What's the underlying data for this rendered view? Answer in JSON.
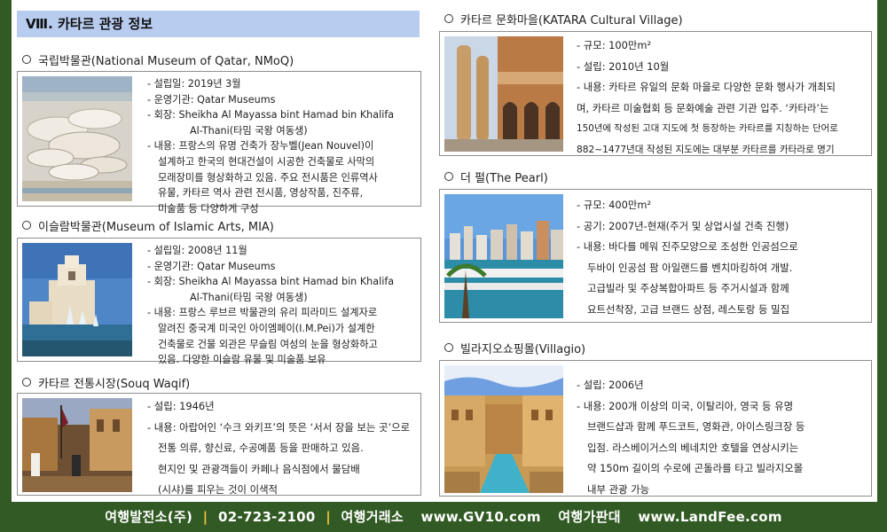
{
  "section_title": "Ⅷ. 카타르 관광 정보",
  "left": [
    {
      "heading": "국립박물관(National Museum of Qatar, NMoQ)",
      "image": "national-museum-photo",
      "lines": [
        "- 설립일: 2019년 3월",
        "- 운영기관: Qatar Museums",
        "- 회장: Sheikha Al Mayassa bint Hamad bin Khalifa",
        "Al-Thani(타밈 국왕 여동생)",
        "- 내용: 프랑스의 유명 건축가 장누벨(Jean Nouvel)이",
        "설계하고 한국의 현대건설이 시공한 건축물로 사막의",
        "모래장미를 형상화하고 있음. 주요 전시품은 인류역사",
        "유물, 카타르 역사 관련 전시품,  영상작품, 진주류,",
        "미술품 등 다양하게 구성"
      ]
    },
    {
      "heading": "이슬람박물관(Museum of Islamic Arts, MIA)",
      "image": "islamic-museum-photo",
      "lines": [
        "- 설립일: 2008년 11월",
        "- 운영기관: Qatar Museums",
        "- 회장: Sheikha Al Mayassa bint Hamad bin Khalifa",
        "Al-Thani(타밈 국왕 여동생)",
        "- 내용: 프랑스 루브르 박물관의 유리 피라미드 설계자로",
        "알려진 중국계 미국인 아이엠페이(I.M.Pei)가 설계한",
        "건축물로 건물 외관은 무슬림 여성의 눈을 형상화하고",
        "있음. 다양한 이슬람 유물 및 미술품 보유"
      ]
    },
    {
      "heading": "카타르 전통시장(Souq Waqif)",
      "image": "souq-waqif-photo",
      "lines": [
        "- 설립: 1946년",
        "- 내용: 아랍어인 ‘수크 와키프’의 뜻은 ‘서서 장을  보는 곳’으로",
        "전통 의류, 향신료, 수공예품 등을 판매하고 있음.",
        "현지인 및  관광객들이 카페나 음식점에서 물담배",
        "(시샤)를 피우는 것이 이색적"
      ]
    }
  ],
  "right": [
    {
      "heading": "카타르 문화마을(KATARA Cultural Village)",
      "image": "katara-village-photo",
      "lines": [
        "- 규모: 100만m²",
        "- 설립: 2010년 10월",
        "- 내용: 카타르 유일의 문화 마을로 다양한 문화 행사가 개최되",
        "며, 카타르 미술협회 등 문화예술 관련  기관 입주. ‘카타라’는",
        "150년에 작성된 고대 지도에 첫 등장하는 카타르를 지칭하는 단어로",
        "882~1477년대 작성된 지도에는 대부분 카타르를 카타라로 명기"
      ]
    },
    {
      "heading": "더 펄(The Pearl)",
      "image": "the-pearl-photo",
      "lines": [
        "- 규모: 400만m²",
        "- 공기: 2007년-현재(주거 및 상업시설 건축 진행)",
        "- 내용: 바다를 메워 진주모양으로 조성한 인공섬으로",
        "두바이 인공섬 팜 아일랜드를 벤치마킹하여 개발.",
        "고급빌라 및 주상복합아파트 등 주거시설과 함께",
        "요트선착장, 고급 브랜드 상점, 레스토랑 등 밀집"
      ]
    },
    {
      "heading": "빌라지오쇼핑몰(Villagio)",
      "image": "villagio-mall-photo",
      "lines": [
        "- 설립: 2006년",
        "- 내용: 200개 이상의 미국, 이탈리아, 영국 등 유명",
        "브랜드샵과 함께 푸드코트, 영화관, 아이스링크장 등",
        "입점. 라스베이거스의 베네치안 호텔을 연상시키는",
        "약 150m 길이의 수로에 곤돌라를 타고 빌라지오몰",
        "내부 관광 가능"
      ]
    }
  ],
  "footer": {
    "company": "여행발전소(주)",
    "sep": "|",
    "phone": "02-723-2100",
    "label1": "여행거래소",
    "site1": "www.GV10.com",
    "label2": "여행가판대",
    "site2": "www.LandFee.com"
  }
}
